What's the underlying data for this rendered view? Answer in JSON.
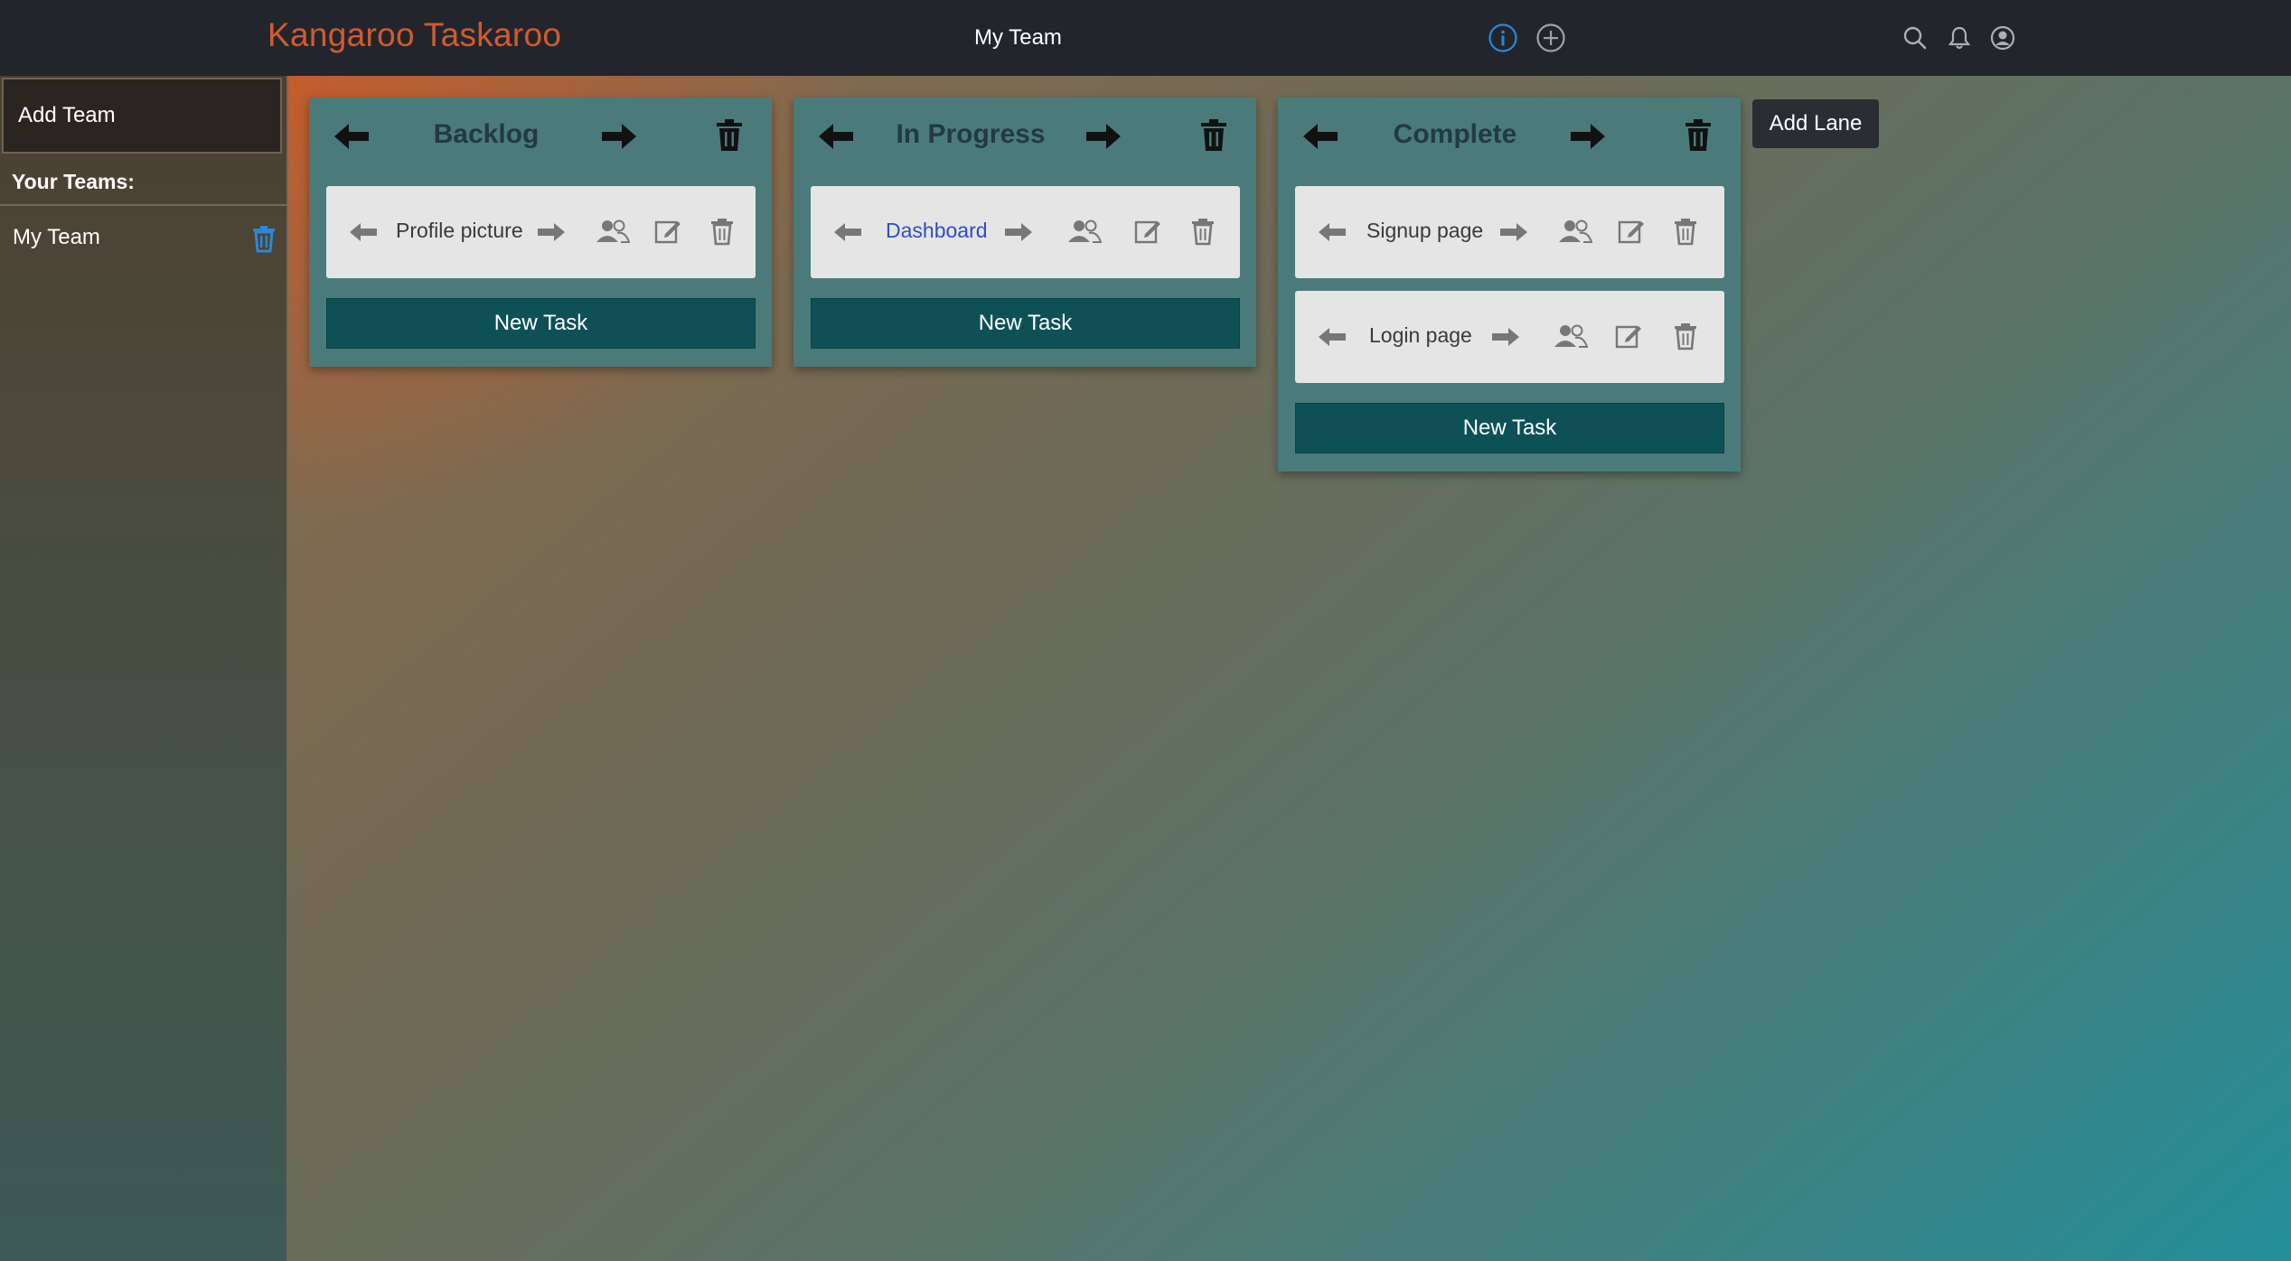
{
  "header": {
    "brand": "Kangaroo Taskaroo",
    "team_title": "My Team",
    "icons": [
      "info-icon",
      "add-circle-icon",
      "search-icon",
      "bell-icon",
      "user-circle-icon"
    ],
    "brand_color": "#d45a2e",
    "info_color": "#2f86d6"
  },
  "sidebar": {
    "add_team_label": "Add Team",
    "section_label": "Your Teams:",
    "teams": [
      {
        "label": "My Team"
      }
    ],
    "delete_icon_color": "#2f86d6"
  },
  "board": {
    "add_lane_label": "Add Lane",
    "lanes": [
      {
        "title": "Backlog",
        "tasks": [
          {
            "name": "Profile picture"
          }
        ],
        "new_task_label": "New Task"
      },
      {
        "title": "In Progress",
        "tasks": [
          {
            "name": "Dashboard"
          }
        ],
        "new_task_label": "New Task"
      },
      {
        "title": "Complete",
        "tasks": [
          {
            "name": "Signup page"
          },
          {
            "name": "Login page"
          }
        ],
        "new_task_label": "New Task"
      }
    ]
  }
}
